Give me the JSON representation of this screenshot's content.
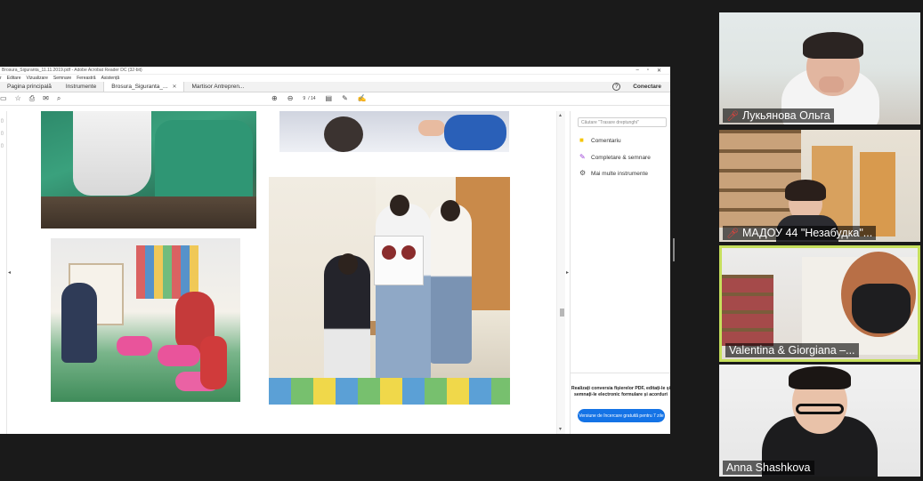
{
  "acrobat": {
    "window_title": "Brosura_Siguranta_11.11.2019.pdf - Adobe Acrobat Reader DC (32-bit)",
    "menu": [
      "r",
      "Editare",
      "Vizualizare",
      "Semnare",
      "Fereastră",
      "Asistență"
    ],
    "nav_tabs": [
      "Pagina principală",
      "Instrumente"
    ],
    "doc_tabs": [
      {
        "label": "Brosura_Siguranta_...",
        "active": true
      },
      {
        "label": "Martisor Antrepren...",
        "active": false
      }
    ],
    "connect_label": "Conectare",
    "page_current": "9",
    "page_total": "/ 14",
    "right_pane": {
      "search_placeholder": "Căutare \"Trasare dreptunghi\"",
      "tools": [
        {
          "label": "Comentariu",
          "icon": "comment-icon",
          "color": "#f5c400"
        },
        {
          "label": "Completare & semnare",
          "icon": "fill-sign-icon",
          "color": "#9b3fd6"
        },
        {
          "label": "Mai multe instrumente",
          "icon": "more-tools-icon",
          "color": "#555555"
        }
      ],
      "promo_text": "Realizați conversia fișierelor PDF, editați-le și semnați-le electronic formulare și acorduri",
      "promo_button": "Versiune de încercare gratuită pentru 7 zile"
    }
  },
  "participants": [
    {
      "name": "Лукьянова Ольга",
      "muted": true
    },
    {
      "name": "МАДОУ 44 \"Незабудка\"...",
      "muted": true
    },
    {
      "name": "Valentina & Giorgiana –...",
      "muted": false,
      "speaking": true
    },
    {
      "name": "Anna Shashkova",
      "muted": false
    }
  ],
  "colors": {
    "background": "#1a1a1a",
    "active_speaker_border": "#c6df5c",
    "muted_icon": "#e8423b",
    "acrobat_blue": "#1473e6"
  }
}
